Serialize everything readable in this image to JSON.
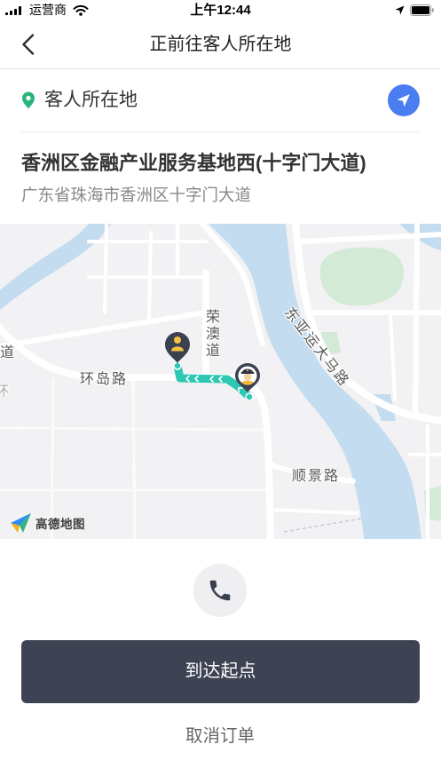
{
  "status_bar": {
    "carrier": "运营商",
    "time": "上午12:44",
    "icons": [
      "signal-icon",
      "wifi-icon",
      "location-arrow-icon",
      "battery-icon"
    ]
  },
  "nav": {
    "title": "正前往客人所在地",
    "back_icon": "chevron-left-icon"
  },
  "pickup": {
    "icon": "location-pin-icon",
    "label": "客人所在地",
    "navigate_icon": "navigation-arrow-icon",
    "address_title": "香洲区金融产业服务基地西(十字门大道)",
    "address_detail": "广东省珠海市香洲区十字门大道"
  },
  "map": {
    "road_labels": {
      "rongao": "荣澳道",
      "huandao": "环岛路",
      "dongyayun": "东亚运大马路",
      "shunjing": "顺景路",
      "left_edge_1": "道",
      "left_edge_2": "环"
    },
    "provider_logo_text": "高德地图",
    "markers": [
      "passenger-marker-icon",
      "driver-marker-icon"
    ]
  },
  "actions": {
    "call_icon": "phone-icon",
    "arrive_label": "到达起点",
    "cancel_label": "取消订单"
  },
  "colors": {
    "primary_button": "#3e4354",
    "accent_blue": "#4a7df0",
    "pin_green": "#27b57b",
    "route_teal": "#2ec7b3",
    "map_water": "#c3dcf0",
    "map_park": "#d3ead6",
    "text_primary": "#333333",
    "text_secondary": "#888888"
  }
}
